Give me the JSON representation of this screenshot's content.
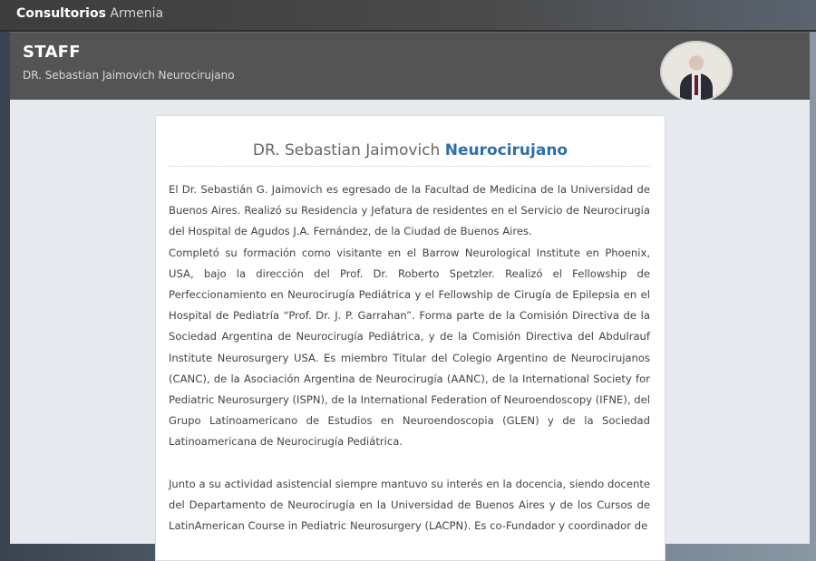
{
  "brand": {
    "part1": "Consultorios",
    "part2": "Armenia"
  },
  "banner": {
    "title": "STAFF",
    "subtitle": "DR. Sebastian Jaimovich Neurocirujano"
  },
  "profile": {
    "name": "DR. Sebastian Jaimovich",
    "specialty": "Neurocirujano",
    "paragraphs": [
      "El Dr. Sebastián G. Jaimovich es egresado de la Facultad de Medicina de la Universidad de Buenos Aires. Realizó su Residencia y Jefatura de residentes en el Servicio de Neurocirugía del Hospital de Agudos J.A. Fernández, de la Ciudad de Buenos Aires.",
      "Completó su formación como visitante en el Barrow Neurological Institute en Phoenix, USA, bajo la dirección del Prof. Dr. Roberto Spetzler. Realizó el Fellowship de Perfeccionamiento en Neurocirugía Pediátrica y el Fellowship de Cirugía de Epilepsia en el Hospital de Pediatría “Prof. Dr. J. P. Garrahan”. Forma parte de la Comisión Directiva de la Sociedad Argentina de Neurocirugía Pediátrica, y de la Comisión Directiva del Abdulrauf Institute Neurosurgery USA. Es miembro Titular del Colegio Argentino de Neurocirujanos (CANC), de la Asociación Argentina de Neurocirugía (AANC), de la International Society for Pediatric Neurosurgery (ISPN), de la International Federation of Neuroendoscopy (IFNE), del Grupo Latinoamericano de Estudios en Neuroendoscopia (GLEN) y de la Sociedad Latinoamericana de Neurocirugía Pediátrica.",
      "Junto a su actividad asistencial siempre mantuvo su interés en la docencia, siendo docente del Departamento de Neurocirugía en la Universidad de Buenos Aires y de los Cursos de LatinAmerican Course in Pediatric Neurosurgery (LACPN). Es co-Fundador y coordinador de"
    ]
  },
  "icons": {
    "avatar": "doctor-photo"
  }
}
